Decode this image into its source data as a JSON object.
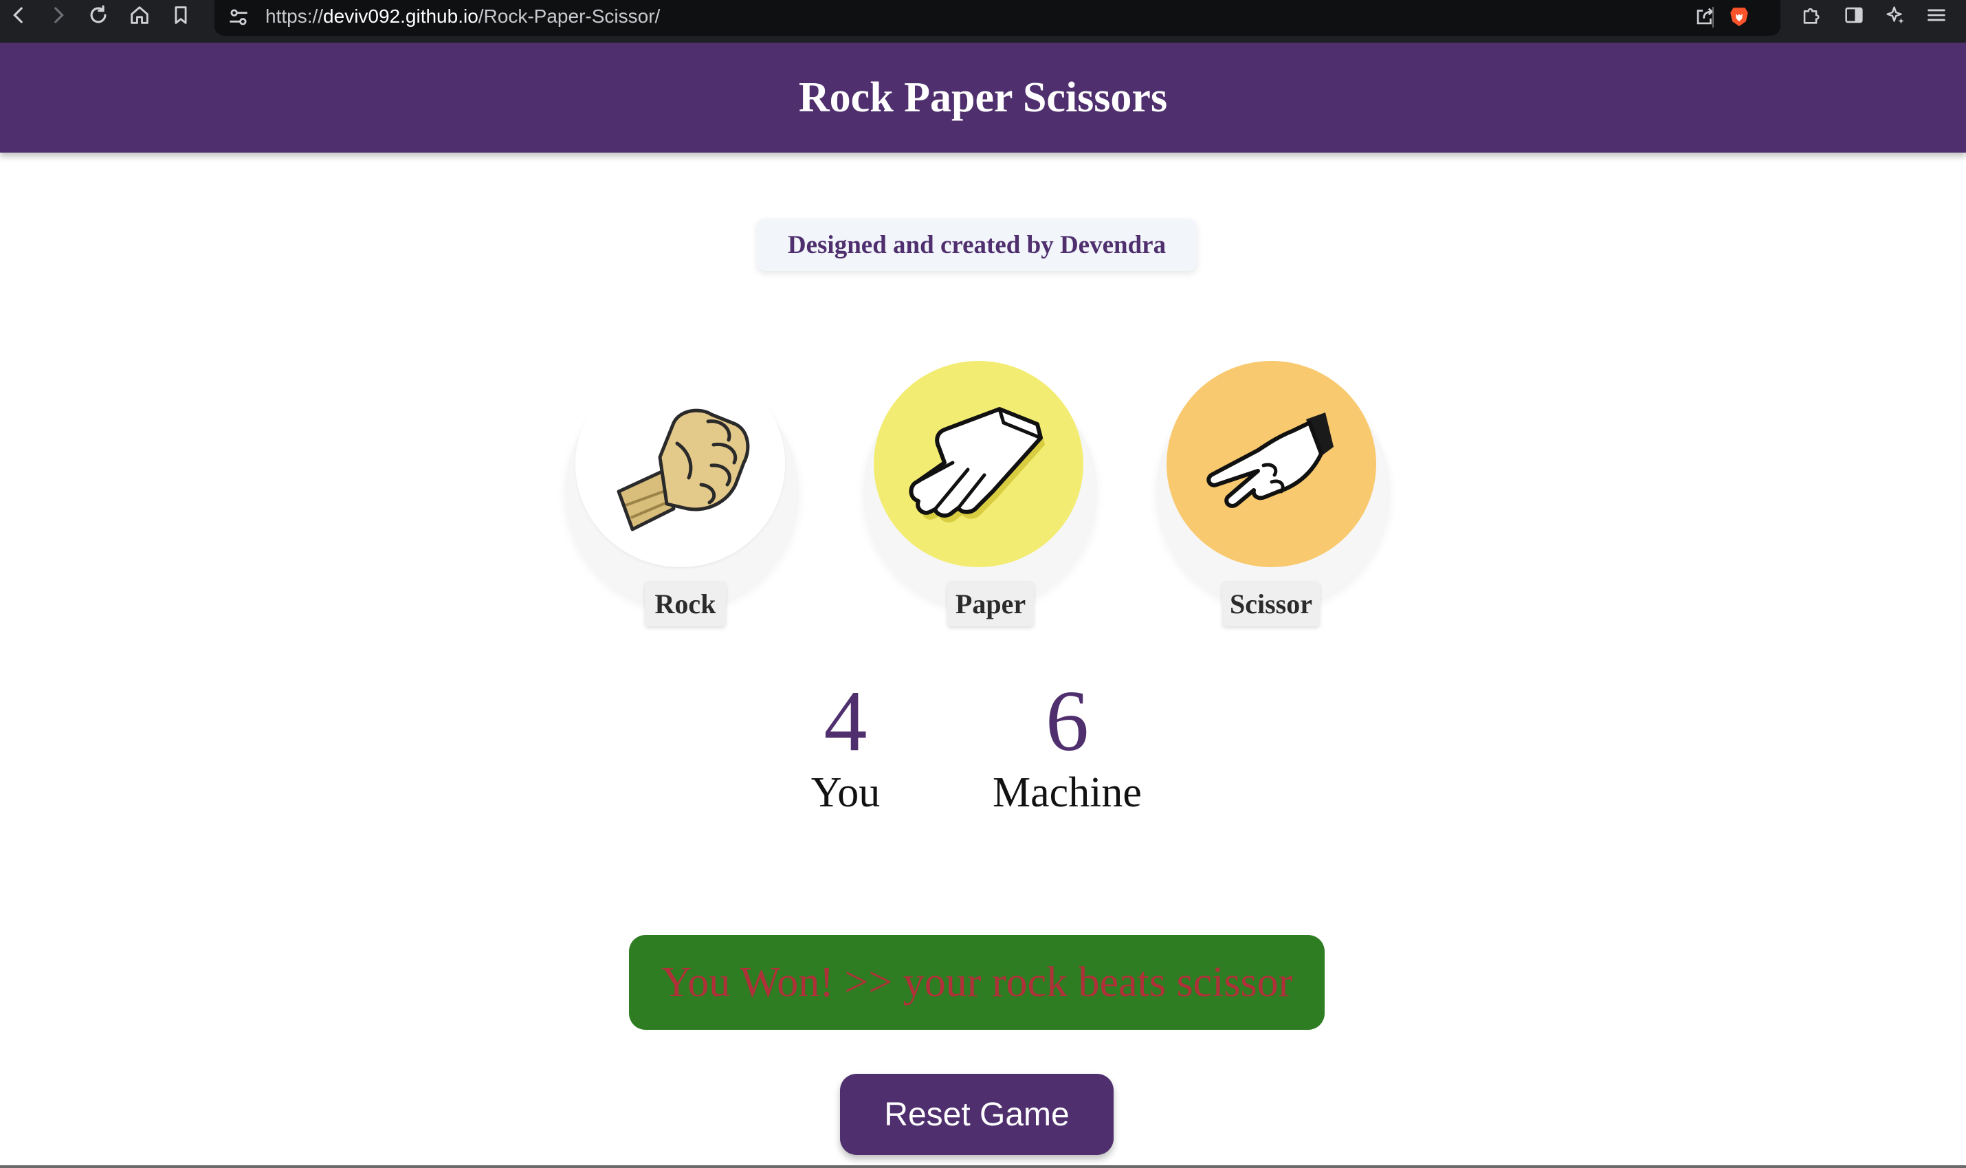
{
  "browser": {
    "url_scheme": "https://",
    "url_host": "deviv092.github.io",
    "url_path": "/Rock-Paper-Scissor/"
  },
  "header": {
    "title": "Rock Paper Scissors"
  },
  "credit": "Designed and created by Devendra",
  "choices": [
    {
      "label": "Rock",
      "icon": "fist-icon",
      "color": "#ffffff"
    },
    {
      "label": "Paper",
      "icon": "open-hand-icon",
      "color": "#f3ec72"
    },
    {
      "label": "Scissor",
      "icon": "scissor-hand-icon",
      "color": "#f8c96e"
    }
  ],
  "scores": {
    "user": {
      "value": "4",
      "label": "You"
    },
    "machine": {
      "value": "6",
      "label": "Machine"
    }
  },
  "message": "You Won! >> your rock beats scissor",
  "reset_label": "Reset Game",
  "colors": {
    "brand": "#4f2f6e",
    "message_bg": "#2e7d22",
    "message_text": "#b0303a"
  }
}
